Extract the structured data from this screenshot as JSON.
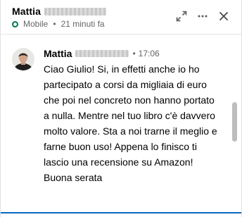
{
  "header": {
    "contact_name": "Mattia",
    "status": "Mobile",
    "last_seen": "21 minuti fa",
    "separator": "•",
    "icons": [
      "expand-icon",
      "more-options-icon",
      "close-icon"
    ]
  },
  "message": {
    "sender": "Mattia",
    "separator": "•",
    "time": "17:06",
    "text": "Ciao Giulio! Si, in effetti anche io ho\npartecipato a corsi da migliaia di euro\nche poi nel concreto non hanno portato\na nulla. Mentre nel tuo libro c'è davvero\nmolto valore. Sta a noi trarne il meglio e\nfarne buon uso! Appena lo finisco ti\nlascio una recensione su Amazon!\nBuona serata"
  },
  "colors": {
    "online": "#057642",
    "accent": "#0a66c2",
    "muted_text": "#666666"
  }
}
